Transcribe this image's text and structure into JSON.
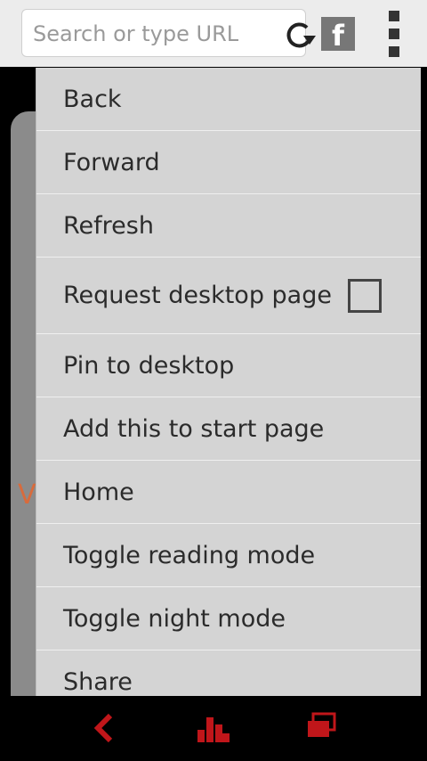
{
  "address_bar": {
    "placeholder": "Search or type URL"
  },
  "menu": {
    "items": [
      {
        "label": "Back"
      },
      {
        "label": "Forward"
      },
      {
        "label": "Refresh"
      },
      {
        "label": "Request desktop page",
        "checked": false
      },
      {
        "label": "Pin to desktop"
      },
      {
        "label": "Add this to start page"
      },
      {
        "label": "Home"
      },
      {
        "label": "Toggle reading mode"
      },
      {
        "label": "Toggle night mode"
      },
      {
        "label": "Share"
      }
    ]
  },
  "icons": {
    "reload": "reload-icon",
    "facebook": "facebook-icon",
    "more": "more-vertical-icon",
    "back": "chevron-left-icon",
    "speed_dial": "speed-dial-icon",
    "tabs": "tabs-icon"
  },
  "colors": {
    "accent_red": "#c0161a"
  }
}
